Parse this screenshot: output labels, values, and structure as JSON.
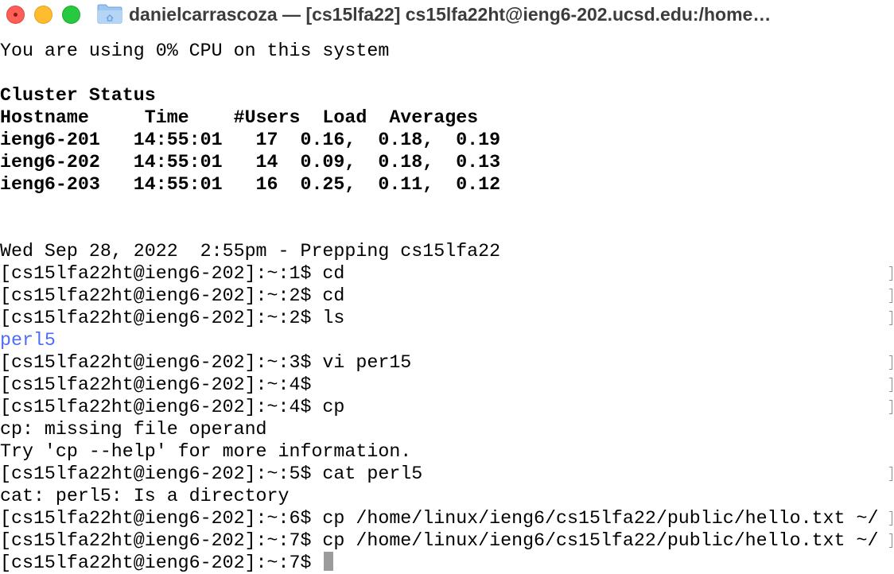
{
  "window": {
    "title": "danielcarrascoza — [cs15lfa22]  cs15lfa22ht@ieng6-202.ucsd.edu:/home…",
    "icon": "folder-icon",
    "colors": {
      "close": "#ff5f57",
      "minimize": "#febc2e",
      "maximize": "#28c840",
      "link_blue": "#4f6cf7"
    }
  },
  "terminal": {
    "lines": [
      {
        "text": "You are using 0% CPU on this system"
      },
      {
        "text": ""
      },
      {
        "text": "Cluster Status"
      },
      {
        "text": "Hostname     Time    #Users  Load  Averages"
      },
      {
        "text": "ieng6-201   14:55:01   17  0.16,  0.18,  0.19"
      },
      {
        "text": "ieng6-202   14:55:01   14  0.09,  0.18,  0.13"
      },
      {
        "text": "ieng6-203   14:55:01   16  0.25,  0.11,  0.12"
      },
      {
        "text": ""
      },
      {
        "text": ""
      },
      {
        "text": "Wed Sep 28, 2022  2:55pm - Prepping cs15lfa22"
      },
      {
        "text": "[cs15lfa22ht@ieng6-202]:~:1$ cd"
      },
      {
        "text": "[cs15lfa22ht@ieng6-202]:~:2$ cd"
      },
      {
        "text": "[cs15lfa22ht@ieng6-202]:~:2$ ls"
      },
      {
        "text": "perl5"
      },
      {
        "text": "[cs15lfa22ht@ieng6-202]:~:3$ vi per15"
      },
      {
        "text": "[cs15lfa22ht@ieng6-202]:~:4$"
      },
      {
        "text": "[cs15lfa22ht@ieng6-202]:~:4$ cp"
      },
      {
        "text": "cp: missing file operand"
      },
      {
        "text": "Try 'cp --help' for more information."
      },
      {
        "text": "[cs15lfa22ht@ieng6-202]:~:5$ cat perl5"
      },
      {
        "text": "cat: perl5: Is a directory"
      },
      {
        "text": "[cs15lfa22ht@ieng6-202]:~:6$ cp /home/linux/ieng6/cs15lfa22/public/hello.txt ~/"
      },
      {
        "text": "[cs15lfa22ht@ieng6-202]:~:7$ cp /home/linux/ieng6/cs15lfa22/public/hello.txt ~/"
      },
      {
        "text": "[cs15lfa22ht@ieng6-202]:~:7$ "
      }
    ]
  }
}
